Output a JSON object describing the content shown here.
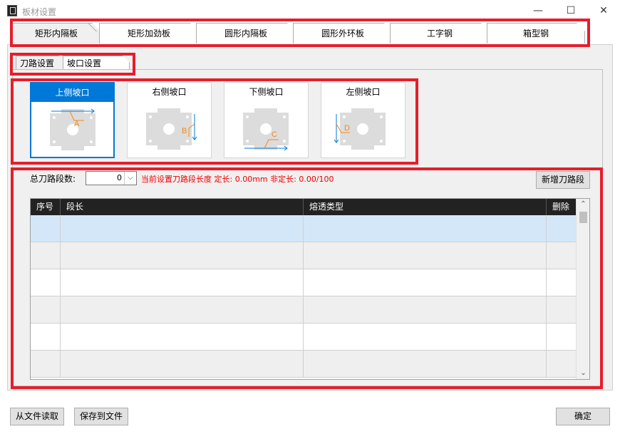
{
  "window": {
    "title": "板材设置",
    "minimize": "—",
    "maximize": "☐",
    "close": "✕"
  },
  "main_tabs": [
    "矩形内隔板",
    "矩形加劲板",
    "圆形内隔板",
    "圆形外环板",
    "工字钢",
    "箱型钢"
  ],
  "sub_tabs": [
    "刀路设置",
    "坡口设置"
  ],
  "bevels": [
    {
      "label": "上侧坡口",
      "letter": "A"
    },
    {
      "label": "右侧坡口",
      "letter": "B"
    },
    {
      "label": "下侧坡口",
      "letter": "C"
    },
    {
      "label": "左侧坡口",
      "letter": "D"
    }
  ],
  "segments": {
    "total_label": "总刀路段数:",
    "total_value": "0",
    "info": "当前设置刀路段长度 定长: 0.00mm  非定长: 0.00/100",
    "add_button": "新增刀路段"
  },
  "table": {
    "columns": [
      "序号",
      "段长",
      "熔透类型",
      "删除"
    ]
  },
  "buttons": {
    "read": "从文件读取",
    "save": "保存到文件",
    "ok": "确定"
  },
  "colors": {
    "highlight": "#e61e2c",
    "selected": "#0078d7",
    "bevel_line": "#f08a1c"
  }
}
